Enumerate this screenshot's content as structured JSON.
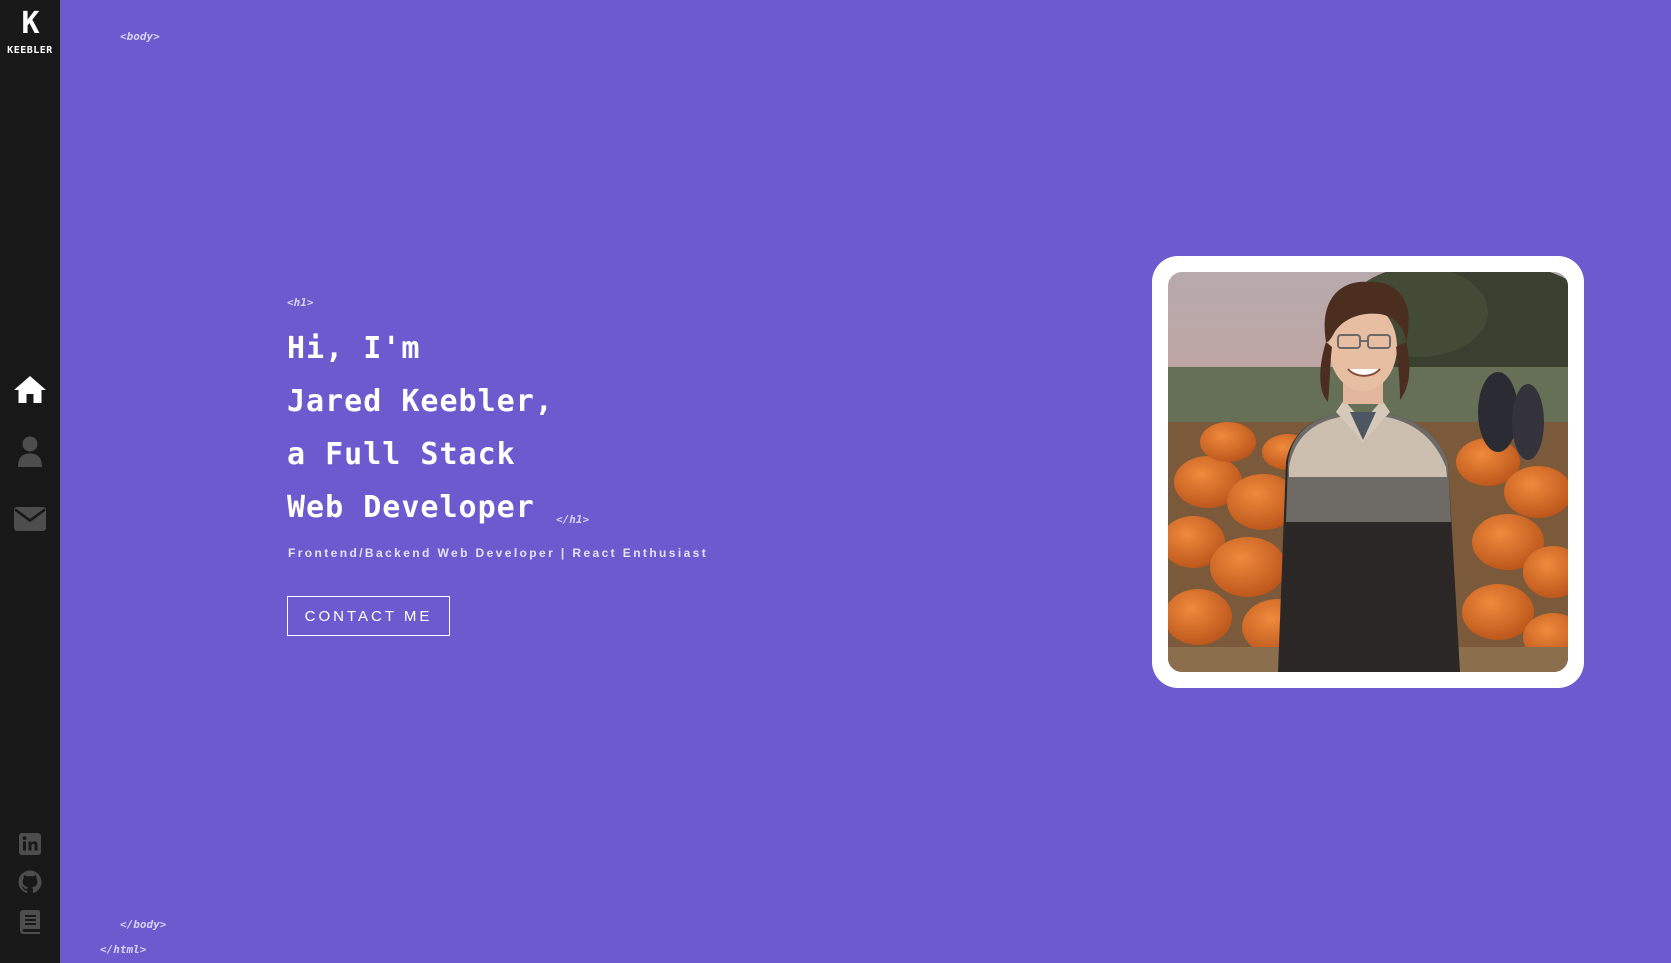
{
  "sidebar": {
    "logo_mark": "K",
    "logo_name": "KEEBLER",
    "nav": [
      {
        "icon": "home-icon",
        "label": "Home",
        "active": true
      },
      {
        "icon": "user-icon",
        "label": "About",
        "active": false
      },
      {
        "icon": "envelope-icon",
        "label": "Contact",
        "active": false
      }
    ],
    "social": [
      {
        "icon": "linkedin-icon"
      },
      {
        "icon": "github-icon"
      },
      {
        "icon": "book-icon"
      }
    ],
    "colors": {
      "background": "#181818",
      "icon_active": "#ffffff",
      "icon_inactive": "#4d4d4d"
    }
  },
  "tags": {
    "body_open": "<body>",
    "h1_open": "<h1>",
    "h1_close": "</h1>",
    "body_close": "</body>",
    "html_close": "</html>"
  },
  "hero": {
    "headline_lines": [
      "Hi, I'm",
      "Jared Keebler,",
      "a Full Stack",
      "Web Developer"
    ],
    "subtitle": "Frontend/Backend Web Developer | React Enthusiast",
    "contact_button": "CONTACT ME"
  },
  "photo": {
    "icon": "profile-photo"
  },
  "colors": {
    "page_background": "#6c5ace",
    "text": "#ffffff",
    "tag_text": "#d8d2f4"
  }
}
